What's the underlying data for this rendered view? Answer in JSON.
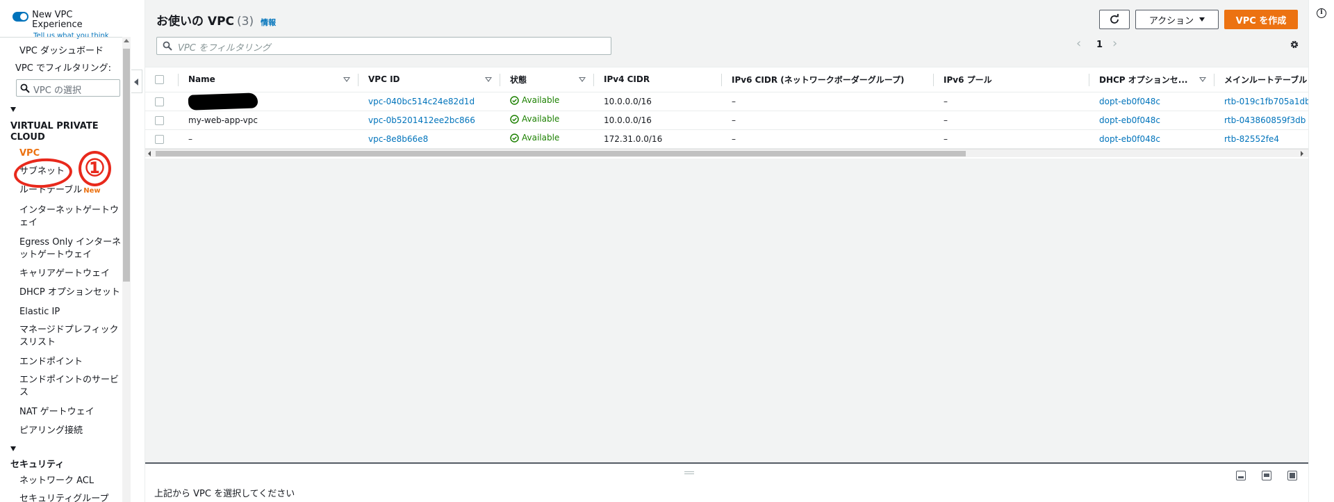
{
  "sidebar": {
    "new_vpc_experience": "New VPC Experience",
    "tell_us": "Tell us what you think",
    "dashboard": "VPC ダッシュボード",
    "filter_label": "VPC でフィルタリング:",
    "vpc_select_placeholder": "VPC の選択",
    "section_vpc": "VIRTUAL PRIVATE CLOUD",
    "items": [
      {
        "label": "VPC"
      },
      {
        "label": "サブネット"
      },
      {
        "label": "ルートテーブル",
        "badge": "New"
      },
      {
        "label": "インターネットゲートウェイ"
      },
      {
        "label": "Egress Only インターネットゲートウェイ"
      },
      {
        "label": "キャリアゲートウェイ"
      },
      {
        "label": "DHCP オプションセット"
      },
      {
        "label": "Elastic IP"
      },
      {
        "label": "マネージドプレフィックスリスト"
      },
      {
        "label": "エンドポイント"
      },
      {
        "label": "エンドポイントのサービス"
      },
      {
        "label": "NAT ゲートウェイ"
      },
      {
        "label": "ピアリング接続"
      }
    ],
    "section_security": "セキュリティ",
    "security_items": [
      {
        "label": "ネットワーク ACL"
      },
      {
        "label": "セキュリティグループ"
      }
    ]
  },
  "header": {
    "title": "お使いの VPC",
    "count": "(3)",
    "info": "情報",
    "filter_placeholder": "VPC をフィルタリング",
    "actions_label": "アクション",
    "create_label": "VPC を作成",
    "page": "1"
  },
  "table": {
    "columns": [
      "Name",
      "VPC ID",
      "状態",
      "IPv4 CIDR",
      "IPv6 CIDR (ネットワークボーダーグループ)",
      "IPv6 プール",
      "DHCP オプションセ...",
      "メインルートテーブル"
    ],
    "rows": [
      {
        "name": "",
        "vpc_id": "vpc-040bc514c24e82d1d",
        "state": "Available",
        "ipv4": "10.0.0.0/16",
        "ipv6": "–",
        "pool": "–",
        "dhcp": "dopt-eb0f048c",
        "rtb": "rtb-019c1fb705a1db"
      },
      {
        "name": "my-web-app-vpc",
        "vpc_id": "vpc-0b5201412ee2bc866",
        "state": "Available",
        "ipv4": "10.0.0.0/16",
        "ipv6": "–",
        "pool": "–",
        "dhcp": "dopt-eb0f048c",
        "rtb": "rtb-043860859f3db"
      },
      {
        "name": "–",
        "vpc_id": "vpc-8e8b66e8",
        "state": "Available",
        "ipv4": "172.31.0.0/16",
        "ipv6": "–",
        "pool": "–",
        "dhcp": "dopt-eb0f048c",
        "rtb": "rtb-82552fe4"
      }
    ]
  },
  "bottom": {
    "message": "上記から VPC を選択してください"
  },
  "annotation": {
    "number": "①"
  },
  "colors": {
    "accent": "#ec7211",
    "link": "#0073bb",
    "success": "#1d8102",
    "annotation": "#e8291c"
  }
}
